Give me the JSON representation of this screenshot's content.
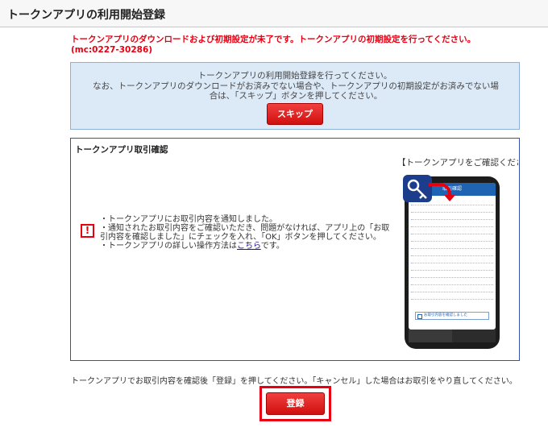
{
  "header": {
    "title": "トークンアプリの利用開始登録"
  },
  "error": {
    "message": "トークンアプリのダウンロードおよび初期設定が未了です。トークンアプリの初期設定を行ってください。(mc:0227-30286)"
  },
  "info": {
    "line1": "トークンアプリの利用開始登録を行ってください。",
    "line2": "なお、トークンアプリのダウンロードがお済みでない場合や、トークンアプリの初期設定がお済みでない場合は、「スキップ」ボタンを押してください。",
    "skip_label": "スキップ"
  },
  "confirm": {
    "title": "トークンアプリ取引確認",
    "phone_caption": "【トークンアプリをご確認ください】",
    "warning_symbol": "!",
    "bullet1": "・トークンアプリにお取引内容を通知しました。",
    "bullet2": "・通知されたお取引内容をご確認いただき、問題がなければ、アプリ上の「お取引内容を確認しました」にチェックを入れ、「OK」ボタンを押してください。",
    "bullet3_prefix": "・トークンアプリの詳しい操作方法は",
    "bullet3_link": "こちら",
    "bullet3_suffix": "です。"
  },
  "phone": {
    "topbar": "取引確認",
    "check_label": "お取引内容を確認しました"
  },
  "footer": {
    "message": "トークンアプリでお取引内容を確認後「登録」を押してください。「キャンセル」した場合はお取引をやり直してください。",
    "register_label": "登録"
  },
  "colors": {
    "error": "#e60012",
    "info_bg": "#dce9f7",
    "confirm_border": "#3a4fa8",
    "button_red": "#d10f0f"
  }
}
